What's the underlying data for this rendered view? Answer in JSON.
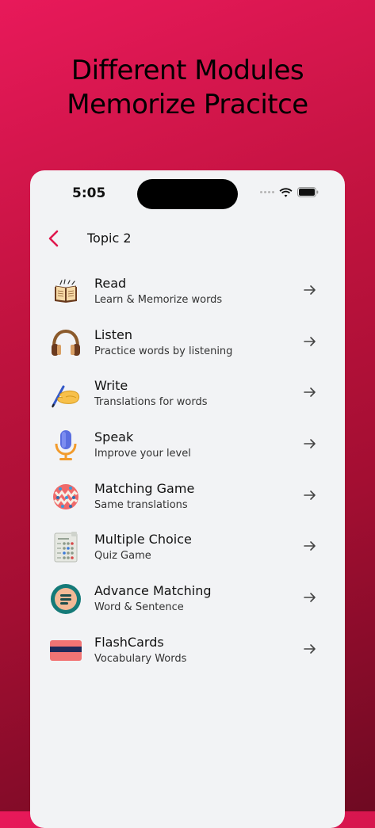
{
  "hero": {
    "line1": "Different Modules",
    "line2": "Memorize Pracitce"
  },
  "status_bar": {
    "time": "5:05"
  },
  "header": {
    "title": "Topic 2",
    "back_icon": "chevron-left-icon"
  },
  "colors": {
    "accent": "#e8195a",
    "background_top": "#e8195a",
    "background_bottom": "#6f0a22",
    "card": "#f2f3f5"
  },
  "modules": [
    {
      "title": "Read",
      "subtitle": "Learn & Memorize words",
      "icon": "open-book-icon"
    },
    {
      "title": "Listen",
      "subtitle": "Practice words by listening",
      "icon": "headphones-icon"
    },
    {
      "title": "Write",
      "subtitle": "Translations for words",
      "icon": "writing-hand-icon"
    },
    {
      "title": "Speak",
      "subtitle": "Improve your level",
      "icon": "microphone-icon"
    },
    {
      "title": "Matching Game",
      "subtitle": "Same translations",
      "icon": "matching-ball-icon"
    },
    {
      "title": "Multiple Choice",
      "subtitle": "Quiz Game",
      "icon": "quiz-sheet-icon"
    },
    {
      "title": "Advance Matching",
      "subtitle": "Word & Sentence",
      "icon": "list-circle-icon"
    },
    {
      "title": "FlashCards",
      "subtitle": "Vocabulary Words",
      "icon": "flashcard-icon"
    }
  ]
}
